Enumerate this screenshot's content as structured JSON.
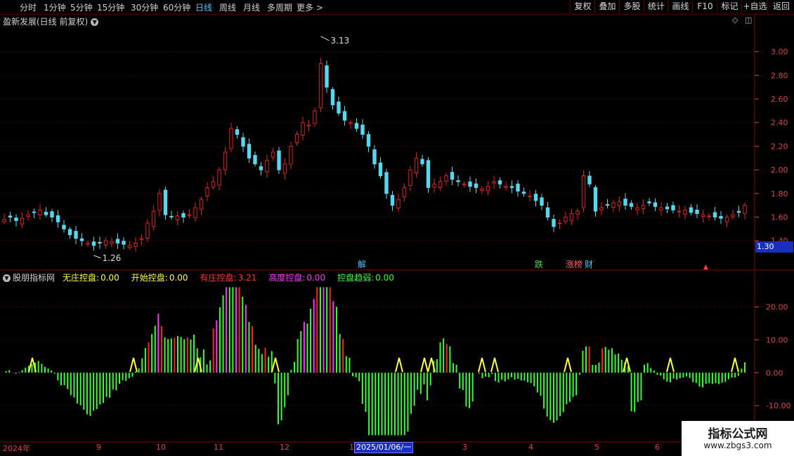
{
  "toolbar": {
    "periods": [
      "分时",
      "1分钟",
      "5分钟",
      "15分钟",
      "30分钟",
      "60分钟",
      "日线",
      "周线",
      "月线",
      "多周期",
      "更多 >"
    ],
    "active_period": "日线",
    "right_buttons": [
      "复权",
      "叠加",
      "多股",
      "统计",
      "画线",
      "F10",
      "标记",
      "+自选",
      "返回"
    ]
  },
  "main_panel": {
    "title": "盈新发展(日线 前复权)",
    "high_label": "3.13",
    "low_label": "1.26",
    "current_price_box": "1.30",
    "y_ticks": [
      "3.00",
      "2.80",
      "2.60",
      "2.40",
      "2.20",
      "2.00",
      "1.80",
      "1.60",
      "1.40"
    ],
    "markers": [
      {
        "text": "解",
        "color": "#4fc3ff"
      },
      {
        "text": "跌",
        "color": "#4fd84f"
      },
      {
        "text": "涨榜",
        "color": "#ff6060"
      },
      {
        "text": "财",
        "color": "#4fc3ff"
      },
      {
        "text": "▲",
        "color": "#ff4040"
      }
    ]
  },
  "indicator_panel": {
    "name": "股朋指标网",
    "items": [
      {
        "label": "无庄控盘:",
        "value": "0.00",
        "color": "#ffff33"
      },
      {
        "label": "开始控盘:",
        "value": "0.00",
        "color": "#ffff33"
      },
      {
        "label": "有庄控盘:",
        "value": "3.21",
        "color": "#ff3030"
      },
      {
        "label": "高度控盘:",
        "value": "0.00",
        "color": "#ff33ff"
      },
      {
        "label": "控盘趋弱:",
        "value": "0.00",
        "color": "#33ff33"
      }
    ],
    "y_ticks": [
      "20.00",
      "10.00",
      "0.00",
      "-10.00"
    ]
  },
  "date_axis": {
    "labels": [
      "2024年",
      "9",
      "10",
      "11",
      "12",
      "1",
      "3",
      "4",
      "5",
      "6"
    ],
    "cursor_date": "2025/01/06/一"
  },
  "watermark": {
    "title": "指标公式网",
    "url": "www.zbgs3.com"
  },
  "colors": {
    "up": "#e02020",
    "down": "#54d8f0",
    "grid": "#6a0000",
    "axis": "#e04040"
  },
  "chart_data": [
    {
      "type": "candlestick",
      "title": "盈新发展(日线 前复权)",
      "ylim": [
        1.3,
        3.2
      ],
      "annotations": [
        {
          "label": "3.13",
          "kind": "high"
        },
        {
          "label": "1.26",
          "kind": "low"
        }
      ],
      "close_trace": [
        1.58,
        1.6,
        1.57,
        1.59,
        1.62,
        1.64,
        1.66,
        1.62,
        1.6,
        1.56,
        1.5,
        1.45,
        1.42,
        1.4,
        1.38,
        1.36,
        1.38,
        1.4,
        1.39,
        1.38,
        1.37,
        1.36,
        1.38,
        1.42,
        1.55,
        1.65,
        1.8,
        1.62,
        1.6,
        1.61,
        1.6,
        1.62,
        1.68,
        1.75,
        1.85,
        1.9,
        2.0,
        2.15,
        2.35,
        2.3,
        2.2,
        2.1,
        2.05,
        2.0,
        2.08,
        2.15,
        2.0,
        2.05,
        2.2,
        2.3,
        2.4,
        2.38,
        2.5,
        2.9,
        2.7,
        2.55,
        2.48,
        2.42,
        2.4,
        2.35,
        2.3,
        2.2,
        2.05,
        1.95,
        1.8,
        1.7,
        1.75,
        1.85,
        2.0,
        2.1,
        2.05,
        1.85,
        1.88,
        1.9,
        1.95,
        1.92,
        1.9,
        1.88,
        1.86,
        1.85,
        1.84,
        1.86,
        1.9,
        1.88,
        1.86,
        1.85,
        1.82,
        1.8,
        1.78,
        1.74,
        1.7,
        1.6,
        1.52,
        1.55,
        1.6,
        1.63,
        1.65,
        1.95,
        1.88,
        1.65,
        1.68,
        1.7,
        1.72,
        1.73,
        1.7,
        1.69,
        1.68,
        1.7,
        1.72,
        1.69,
        1.68,
        1.67,
        1.66,
        1.65,
        1.66,
        1.64,
        1.63,
        1.62,
        1.61,
        1.6,
        1.59,
        1.6,
        1.62,
        1.64,
        1.7
      ]
    },
    {
      "type": "bar",
      "title": "股朋指标网",
      "ylim": [
        -20,
        28
      ],
      "series_names": [
        "无庄控盘",
        "开始控盘",
        "有庄控盘",
        "高度控盘",
        "控盘趋弱"
      ],
      "latest_values": [
        0.0,
        0.0,
        3.21,
        0.0,
        0.0
      ]
    }
  ]
}
